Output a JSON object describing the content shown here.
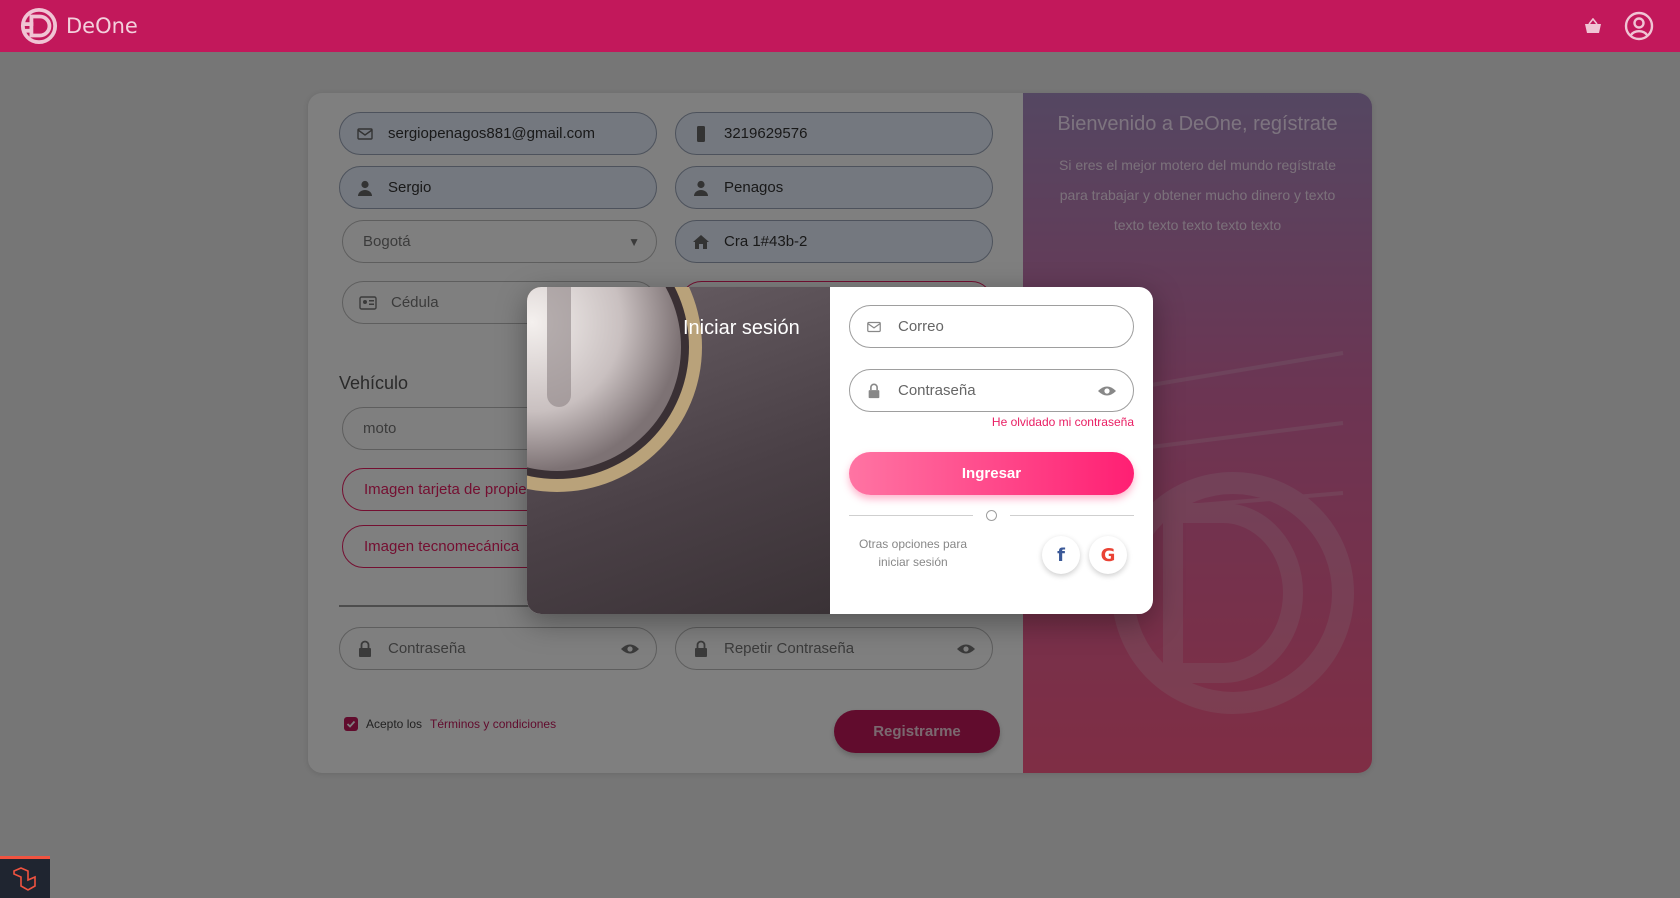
{
  "app": {
    "name": "DeOne"
  },
  "header": {
    "cart_icon": "basket-icon",
    "account_icon": "user-circle-icon"
  },
  "register": {
    "email": "sergiopenagos881@gmail.com",
    "phone": "3219629576",
    "first_name": "Sergio",
    "last_name": "Penagos",
    "city": "Bogotá",
    "address": "Cra 1#43b-2",
    "id_placeholder": "Cédula",
    "vehicle_section": "Vehículo",
    "vehicle_type": "moto",
    "property_card_button": "Imagen tarjeta de propie",
    "techno_button": "Imagen tecnomecánica",
    "password_placeholder": "Contraseña",
    "repeat_password_placeholder": "Repetir Contraseña",
    "terms_prefix": "Acepto los",
    "terms_link": "Términos y condiciones",
    "terms_checked": true,
    "submit": "Registrarme"
  },
  "promo": {
    "title": "Bienvenido a DeOne, regístrate",
    "text": "Si eres el mejor motero del mundo regístrate para trabajar y obtener mucho dinero y texto texto texto texto texto texto"
  },
  "login": {
    "title": "Iniciar sesión",
    "email_placeholder": "Correo",
    "password_placeholder": "Contraseña",
    "forgot": "He olvidado mi contraseña",
    "submit": "Ingresar",
    "other_options": "Otras opciones para iniciar sesión",
    "social": [
      {
        "name": "facebook",
        "glyph": "f",
        "color": "#3b5998"
      },
      {
        "name": "google",
        "glyph": "G",
        "color": "#ea4335"
      }
    ]
  },
  "colors": {
    "brand": "#c2185b",
    "accent": "#ff1f73"
  }
}
